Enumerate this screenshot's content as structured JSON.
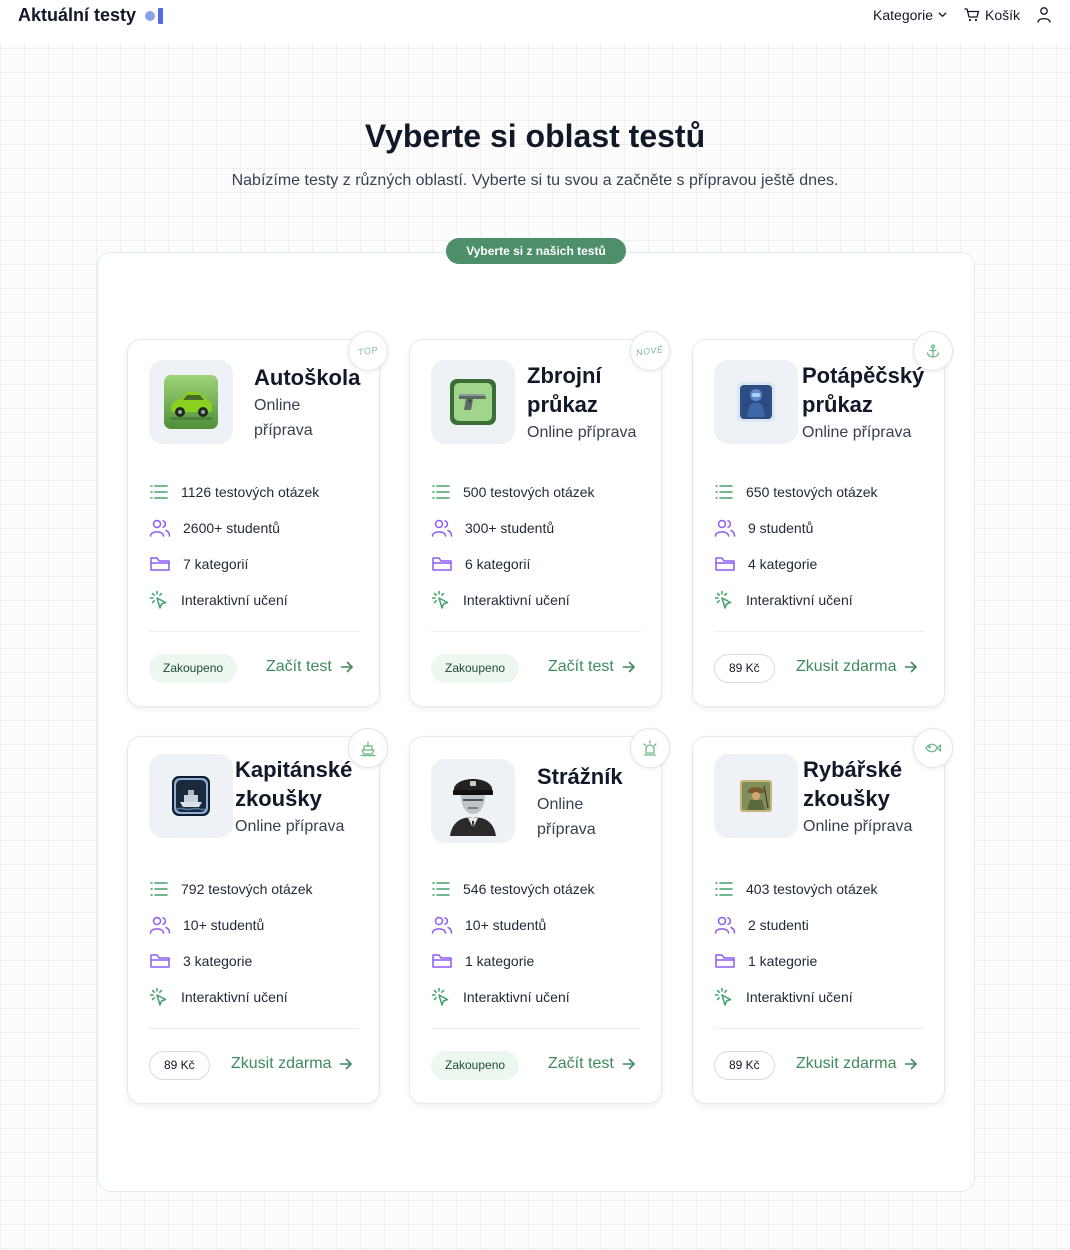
{
  "header": {
    "logo": "Aktuální testy",
    "nav_categories": "Kategorie",
    "nav_cart": "Košík"
  },
  "hero": {
    "title": "Vyberte si oblast testů",
    "subtitle": "Nabízíme testy z různých oblastí. Vyberte si tu svou a začněte s přípravou ještě dnes.",
    "pill": "Vyberte si z našich testů"
  },
  "cards": [
    {
      "title_lines": [
        "Autoškola"
      ],
      "sub_lines": [
        "Online",
        "příprava"
      ],
      "badge": "TOP",
      "badge_icon": "",
      "image": "green-car-image",
      "questions": "1126 testových otázek",
      "students": "2600+ studentů",
      "categories": "7 kategorií",
      "learning": "Interaktivní učení",
      "status": "Zakoupeno",
      "cta": "Začít test"
    },
    {
      "title_lines": [
        "Zbrojní",
        "průkaz"
      ],
      "sub_lines": [
        "Online příprava"
      ],
      "badge": "NOVÉ",
      "badge_icon": "",
      "image": "pistol-image",
      "questions": "500 testových otázek",
      "students": "300+ studentů",
      "categories": "6 kategorií",
      "learning": "Interaktivní učení",
      "status": "Zakoupeno",
      "cta": "Začít test"
    },
    {
      "title_lines": [
        "Potápěčský",
        "průkaz"
      ],
      "sub_lines": [
        "Online příprava"
      ],
      "badge": "",
      "badge_icon": "anchor-icon",
      "image": "diver-image",
      "questions": "650 testových otázek",
      "students": "9 studentů",
      "categories": "4 kategorie",
      "learning": "Interaktivní učení",
      "status": "89 Kč",
      "cta": "Zkusit zdarma"
    },
    {
      "title_lines": [
        "Kapitánské",
        "zkoušky"
      ],
      "sub_lines": [
        "Online příprava"
      ],
      "badge": "",
      "badge_icon": "ship-icon",
      "image": "ship-image",
      "questions": "792 testových otázek",
      "students": "10+ studentů",
      "categories": "3 kategorie",
      "learning": "Interaktivní učení",
      "status": "89 Kč",
      "cta": "Zkusit zdarma"
    },
    {
      "title_lines": [
        "Strážník"
      ],
      "sub_lines": [
        "Online",
        "příprava"
      ],
      "badge": "",
      "badge_icon": "siren-icon",
      "image": "police-officer-image",
      "questions": "546 testových otázek",
      "students": "10+ studentů",
      "categories": "1 kategorie",
      "learning": "Interaktivní učení",
      "status": "Zakoupeno",
      "cta": "Začít test"
    },
    {
      "title_lines": [
        "Rybářské",
        "zkoušky"
      ],
      "sub_lines": [
        "Online příprava"
      ],
      "badge": "",
      "badge_icon": "fish-icon",
      "image": "fisherman-image",
      "questions": "403 testových otázek",
      "students": "2 studenti",
      "categories": "1 kategorie",
      "learning": "Interaktivní učení",
      "status": "89 Kč",
      "cta": "Zkusit zdarma"
    }
  ],
  "colors": {
    "accent": "#3f8a5e",
    "pill": "#4d8f6b",
    "purple_icon": "#8b5cf6",
    "list_icon": "#43a06b"
  }
}
